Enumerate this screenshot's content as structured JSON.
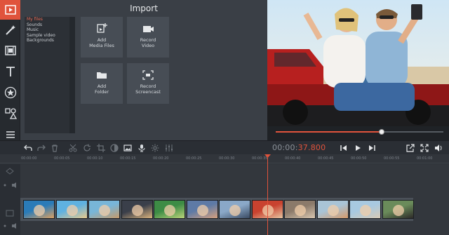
{
  "import": {
    "title": "Import",
    "files": [
      "My files",
      "Sounds",
      "Music",
      "Sample video",
      "Backgrounds"
    ],
    "buttons": {
      "add_media": "Add\nMedia Files",
      "record_video": "Record\nVideo",
      "add_folder": "Add\nFolder",
      "record_screencast": "Record\nScreencast"
    }
  },
  "player": {
    "progress": 0.63,
    "timecode_dim": "00:00:",
    "timecode_hi": "37.800"
  },
  "ruler": {
    "ticks": [
      "00:00:00",
      "00:00:05",
      "00:00:10",
      "00:00:15",
      "00:00:20",
      "00:00:25",
      "00:00:30",
      "00:00:35",
      "00:00:40",
      "00:00:45",
      "00:00:50",
      "00:00:55",
      "00:01:00"
    ]
  },
  "colors": {
    "accent": "#e0533c",
    "panel": "#3a3f46"
  },
  "icons": {
    "rail": [
      "import-icon",
      "magic-wand-icon",
      "film-icon",
      "text-icon",
      "star-icon",
      "shapes-icon",
      "list-icon"
    ]
  },
  "clips": [
    {
      "c1": "#2a7bb8",
      "c2": "#d9a063"
    },
    {
      "c1": "#5fb1e0",
      "c2": "#e7c98d"
    },
    {
      "c1": "#78b6d8",
      "c2": "#c49a6a"
    },
    {
      "c1": "#3a3f4a",
      "c2": "#d8b27d"
    },
    {
      "c1": "#3d8c45",
      "c2": "#b9d37a"
    },
    {
      "c1": "#5e7aa6",
      "c2": "#d6a07e"
    },
    {
      "c1": "#8aa8c8",
      "c2": "#3a4a62"
    },
    {
      "c1": "#c9422f",
      "c2": "#e6c4a0"
    },
    {
      "c1": "#8b7a6a",
      "c2": "#d8c6b0"
    },
    {
      "c1": "#a9c4d6",
      "c2": "#d69a6a"
    },
    {
      "c1": "#a8c9e0",
      "c2": "#d8cbb6"
    },
    {
      "c1": "#6a8b5a",
      "c2": "#2d2a28"
    }
  ]
}
